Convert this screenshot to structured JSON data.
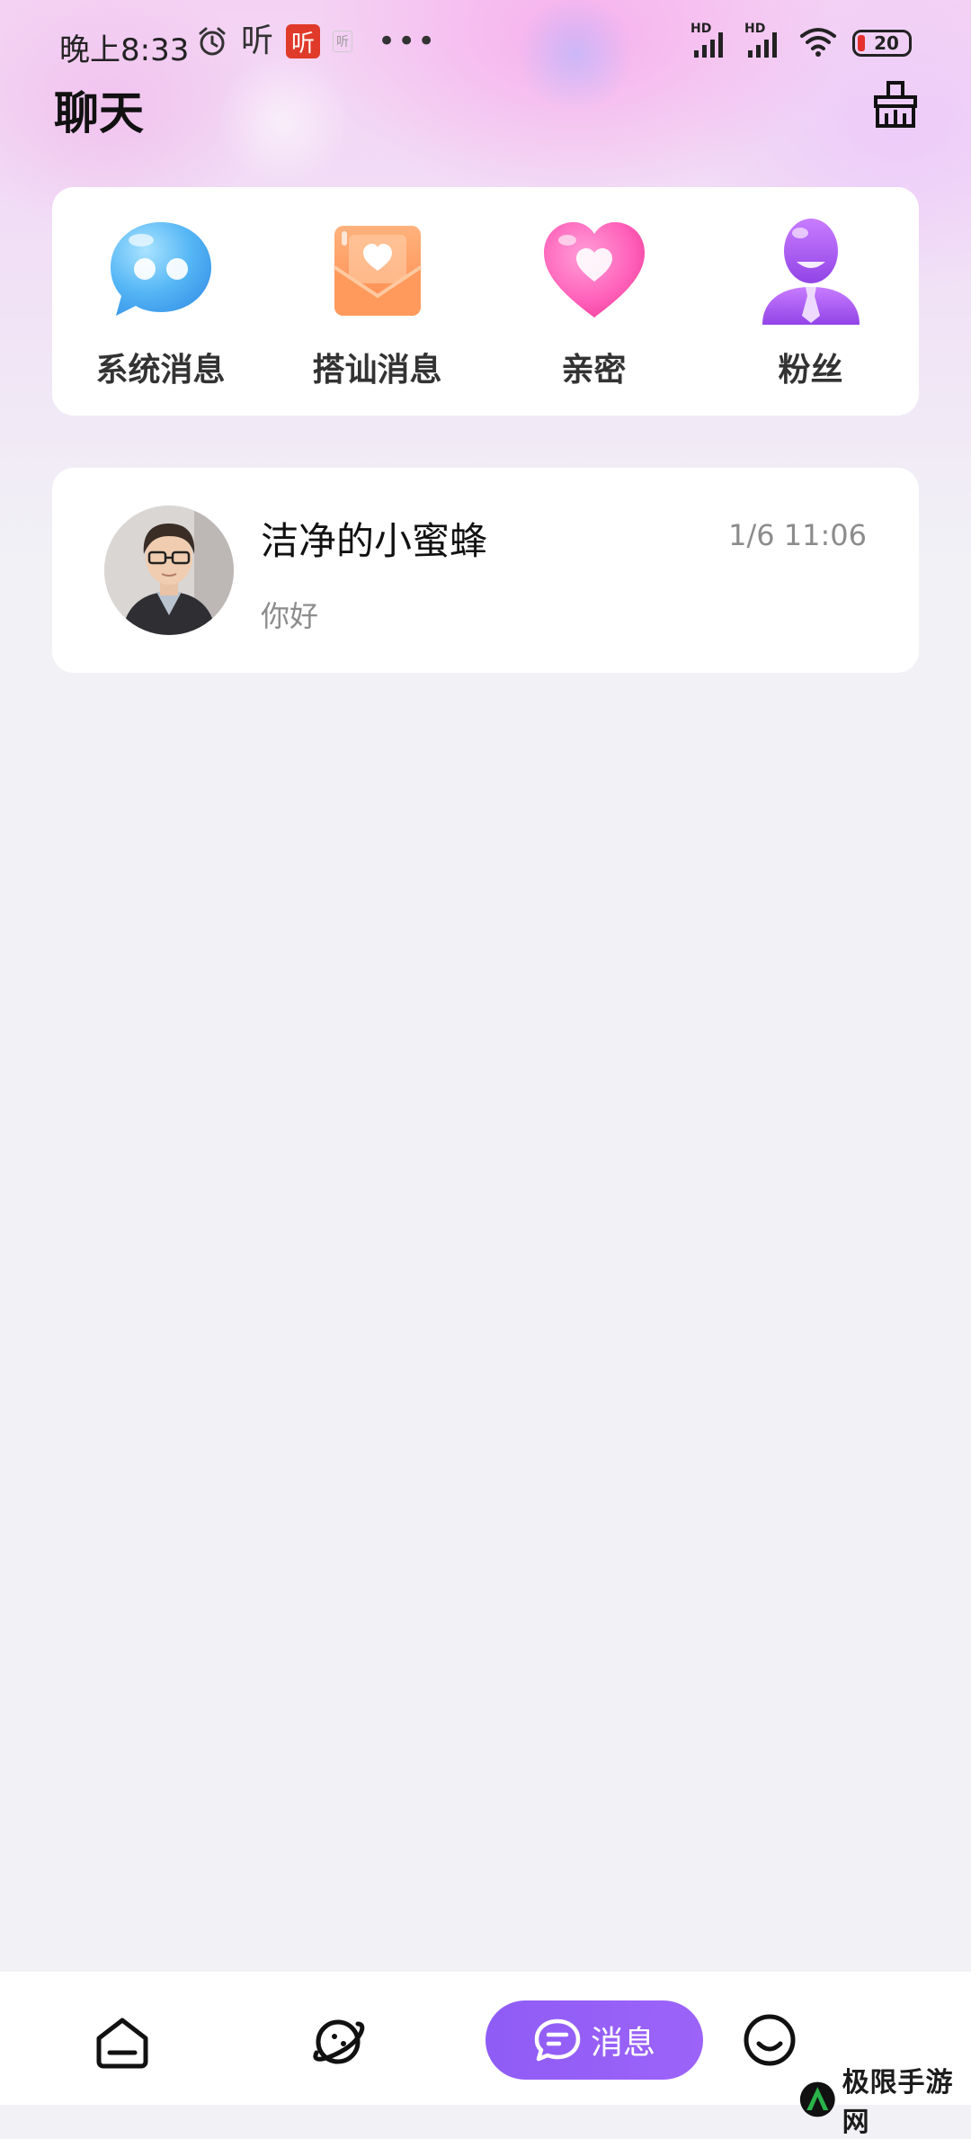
{
  "status_bar": {
    "time": "晚上8:33",
    "ting_text": "听",
    "ting_badge": "听",
    "ting_small": "听",
    "more_dots": "•••",
    "network_1": "HD",
    "network_2": "HD",
    "battery": "20"
  },
  "header": {
    "title": "聊天"
  },
  "quick_entries": [
    {
      "label": "系统消息",
      "icon": "chat-bubble-icon"
    },
    {
      "label": "搭讪消息",
      "icon": "envelope-heart-icon"
    },
    {
      "label": "亲密",
      "icon": "heart-icon"
    },
    {
      "label": "粉丝",
      "icon": "fan-person-icon"
    }
  ],
  "conversations": [
    {
      "name": "洁净的小蜜蜂",
      "time": "1/6 11:06",
      "preview": "你好"
    }
  ],
  "bottom_nav": {
    "messages_label": "消息",
    "active": "messages"
  },
  "watermark": {
    "text": "极限手游网"
  },
  "colors": {
    "accent": "#9060f7",
    "background": "#f1f1f6",
    "badge_red": "#e03a2a"
  }
}
